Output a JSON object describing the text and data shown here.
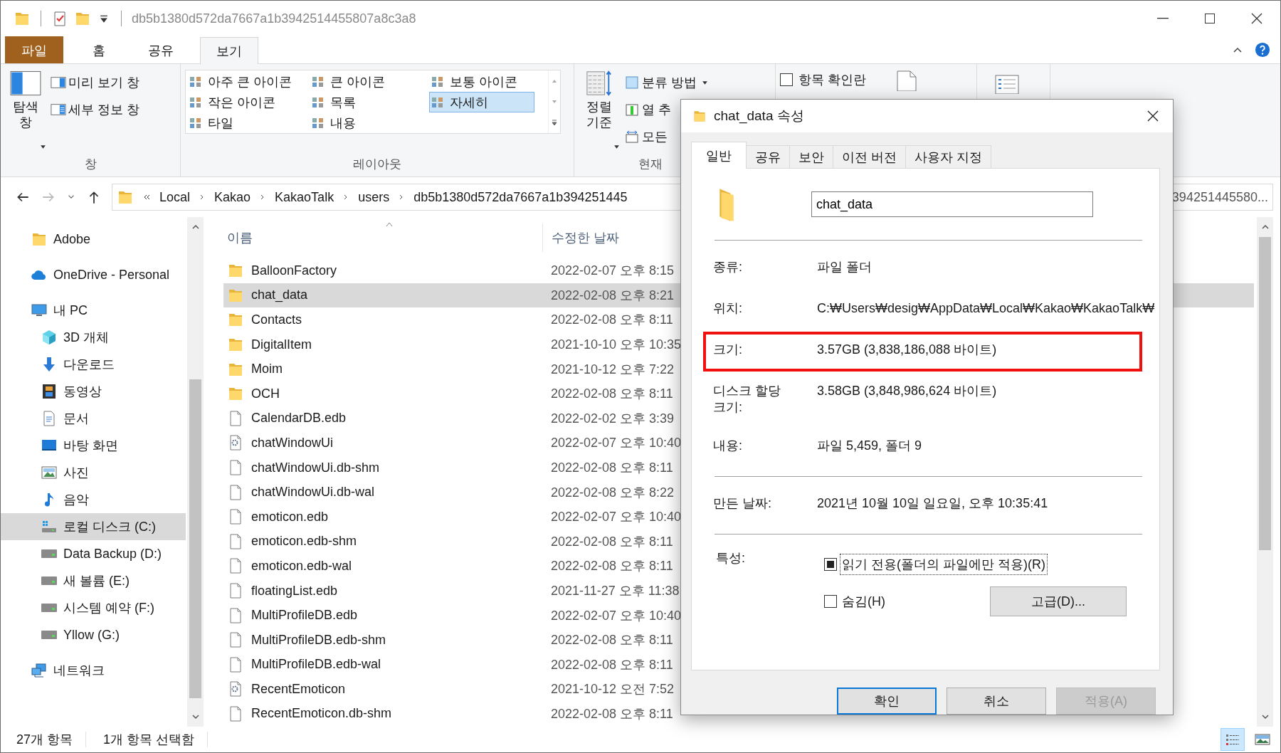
{
  "window": {
    "title": "db5b1380d572da7667a1b3942514455807a8c3a8"
  },
  "ribbon": {
    "tabs": [
      {
        "label": "파일",
        "kind": "menu",
        "selected": false
      },
      {
        "label": "홈",
        "kind": "tab",
        "selected": false
      },
      {
        "label": "공유",
        "kind": "tab",
        "selected": false
      },
      {
        "label": "보기",
        "kind": "tab",
        "selected": true
      }
    ],
    "panes_group": {
      "navigation_pane": "탐색 창",
      "preview_pane": "미리 보기 창",
      "details_pane": "세부 정보 창",
      "label": "창"
    },
    "layout_group": {
      "items": [
        {
          "label": "아주 큰 아이콘",
          "selected": false
        },
        {
          "label": "큰 아이콘",
          "selected": false
        },
        {
          "label": "보통 아이콘",
          "selected": false
        },
        {
          "label": "작은 아이콘",
          "selected": false
        },
        {
          "label": "목록",
          "selected": false
        },
        {
          "label": "자세히",
          "selected": true
        },
        {
          "label": "타일",
          "selected": false
        },
        {
          "label": "내용",
          "selected": false
        }
      ],
      "label": "레이아웃"
    },
    "current_view_group": {
      "sort_by": "정렬 기준",
      "group_by": "분류 방법",
      "add_columns": "열 추",
      "size_all": "모든",
      "label": "현재"
    },
    "show_hide_group": {
      "item_checkboxes": {
        "label": "항목 확인란",
        "checked": false
      }
    }
  },
  "address_bar": {
    "breadcrumbs": [
      "Local",
      "Kakao",
      "KakaoTalk",
      "users",
      "db5b1380d572da7667a1b394251445"
    ],
    "search": {
      "placeholder": "394251445580..."
    }
  },
  "navigation_pane": {
    "items": [
      {
        "label": "Adobe",
        "kind": "folder",
        "selected": false
      },
      {
        "label": "OneDrive - Personal",
        "kind": "cloud",
        "selected": false
      },
      {
        "label": "내 PC",
        "kind": "pc",
        "selected": false,
        "children": [
          {
            "label": "3D 개체",
            "kind": "cube",
            "selected": false
          },
          {
            "label": "다운로드",
            "kind": "download",
            "selected": false
          },
          {
            "label": "동영상",
            "kind": "film",
            "selected": false
          },
          {
            "label": "문서",
            "kind": "document",
            "selected": false
          },
          {
            "label": "바탕 화면",
            "kind": "desktop",
            "selected": false
          },
          {
            "label": "사진",
            "kind": "pictures",
            "selected": false
          },
          {
            "label": "음악",
            "kind": "music",
            "selected": false
          },
          {
            "label": "로컬 디스크 (C:)",
            "kind": "system_drive",
            "selected": true
          },
          {
            "label": "Data Backup (D:)",
            "kind": "drive",
            "selected": false
          },
          {
            "label": "새 볼륨 (E:)",
            "kind": "drive",
            "selected": false
          },
          {
            "label": "시스템 예약 (F:)",
            "kind": "drive",
            "selected": false
          },
          {
            "label": "Yllow (G:)",
            "kind": "drive",
            "selected": false
          }
        ]
      },
      {
        "label": "네트워크",
        "kind": "network",
        "selected": false
      }
    ]
  },
  "file_list": {
    "columns": [
      "이름",
      "수정한 날짜"
    ],
    "rows": [
      {
        "name": "BalloonFactory",
        "date": "2022-02-07 오후 8:15",
        "kind": "folder",
        "selected": false
      },
      {
        "name": "chat_data",
        "date": "2022-02-08 오후 8:21",
        "kind": "folder",
        "selected": true
      },
      {
        "name": "Contacts",
        "date": "2022-02-08 오후 8:11",
        "kind": "folder",
        "selected": false
      },
      {
        "name": "DigitalItem",
        "date": "2021-10-10 오후 10:35",
        "kind": "folder",
        "selected": false
      },
      {
        "name": "Moim",
        "date": "2021-10-12 오후 7:22",
        "kind": "folder",
        "selected": false
      },
      {
        "name": "OCH",
        "date": "2022-02-08 오후 8:11",
        "kind": "folder",
        "selected": false
      },
      {
        "name": "CalendarDB.edb",
        "date": "2022-02-02 오후 3:39",
        "kind": "file",
        "selected": false
      },
      {
        "name": "chatWindowUi",
        "date": "2022-02-07 오후 10:40",
        "kind": "config",
        "selected": false
      },
      {
        "name": "chatWindowUi.db-shm",
        "date": "2022-02-08 오후 8:11",
        "kind": "file",
        "selected": false
      },
      {
        "name": "chatWindowUi.db-wal",
        "date": "2022-02-08 오후 8:22",
        "kind": "file",
        "selected": false
      },
      {
        "name": "emoticon.edb",
        "date": "2022-02-07 오후 10:40",
        "kind": "file",
        "selected": false
      },
      {
        "name": "emoticon.edb-shm",
        "date": "2022-02-08 오후 8:11",
        "kind": "file",
        "selected": false
      },
      {
        "name": "emoticon.edb-wal",
        "date": "2022-02-08 오후 8:11",
        "kind": "file",
        "selected": false
      },
      {
        "name": "floatingList.edb",
        "date": "2021-11-27 오후 11:38",
        "kind": "file",
        "selected": false
      },
      {
        "name": "MultiProfileDB.edb",
        "date": "2022-02-07 오후 10:40",
        "kind": "file",
        "selected": false
      },
      {
        "name": "MultiProfileDB.edb-shm",
        "date": "2022-02-08 오후 8:11",
        "kind": "file",
        "selected": false
      },
      {
        "name": "MultiProfileDB.edb-wal",
        "date": "2022-02-08 오후 8:11",
        "kind": "file",
        "selected": false
      },
      {
        "name": "RecentEmoticon",
        "date": "2021-10-12 오전 7:52",
        "kind": "config",
        "selected": false
      },
      {
        "name": "RecentEmoticon.db-shm",
        "date": "2022-02-08 오후 8:11",
        "kind": "file",
        "selected": false
      }
    ]
  },
  "status_bar": {
    "items": [
      "27개 항목",
      "1개 항목 선택함"
    ],
    "view_buttons": [
      {
        "kind": "details",
        "selected": true
      },
      {
        "kind": "large_icons",
        "selected": false
      }
    ]
  },
  "dialog": {
    "title": "chat_data 속성",
    "tabs": [
      {
        "label": "일반",
        "selected": true
      },
      {
        "label": "공유",
        "selected": false
      },
      {
        "label": "보안",
        "selected": false
      },
      {
        "label": "이전 버전",
        "selected": false
      },
      {
        "label": "사용자 지정",
        "selected": false
      }
    ],
    "name_field": {
      "value": "chat_data"
    },
    "sections": [
      [
        {
          "label": "종류:",
          "value": "파일 폴더",
          "highlighted": false
        },
        {
          "label": "위치:",
          "value": "C:₩Users₩desig₩AppData₩Local₩Kakao₩KakaoTalk₩",
          "highlighted": false
        },
        {
          "label": "크기:",
          "value": "3.57GB (3,838,186,088 바이트)",
          "highlighted": true
        },
        {
          "label": "디스크 할당 크기:",
          "value": "3.58GB (3,848,986,624 바이트)",
          "highlighted": false
        },
        {
          "label": "내용:",
          "value": "파일 5,459, 폴더 9",
          "highlighted": false
        }
      ],
      [
        {
          "label": "만든 날짜:",
          "value": "2021년 10월 10일 일요일, 오후 10:35:41",
          "highlighted": false
        }
      ]
    ],
    "attributes": {
      "label": "특성:",
      "options": [
        {
          "label": "읽기 전용(폴더의 파일에만 적용)(R)",
          "checked": false,
          "indeterminate": true,
          "focused": true
        },
        {
          "label": "숨김(H)",
          "checked": false,
          "indeterminate": false,
          "focused": false
        }
      ],
      "advanced_button": "고급(D)..."
    },
    "buttons": [
      {
        "label": "확인",
        "default": true,
        "disabled": false
      },
      {
        "label": "취소",
        "default": false,
        "disabled": false
      },
      {
        "label": "적용(A)",
        "default": false,
        "disabled": true
      }
    ]
  }
}
